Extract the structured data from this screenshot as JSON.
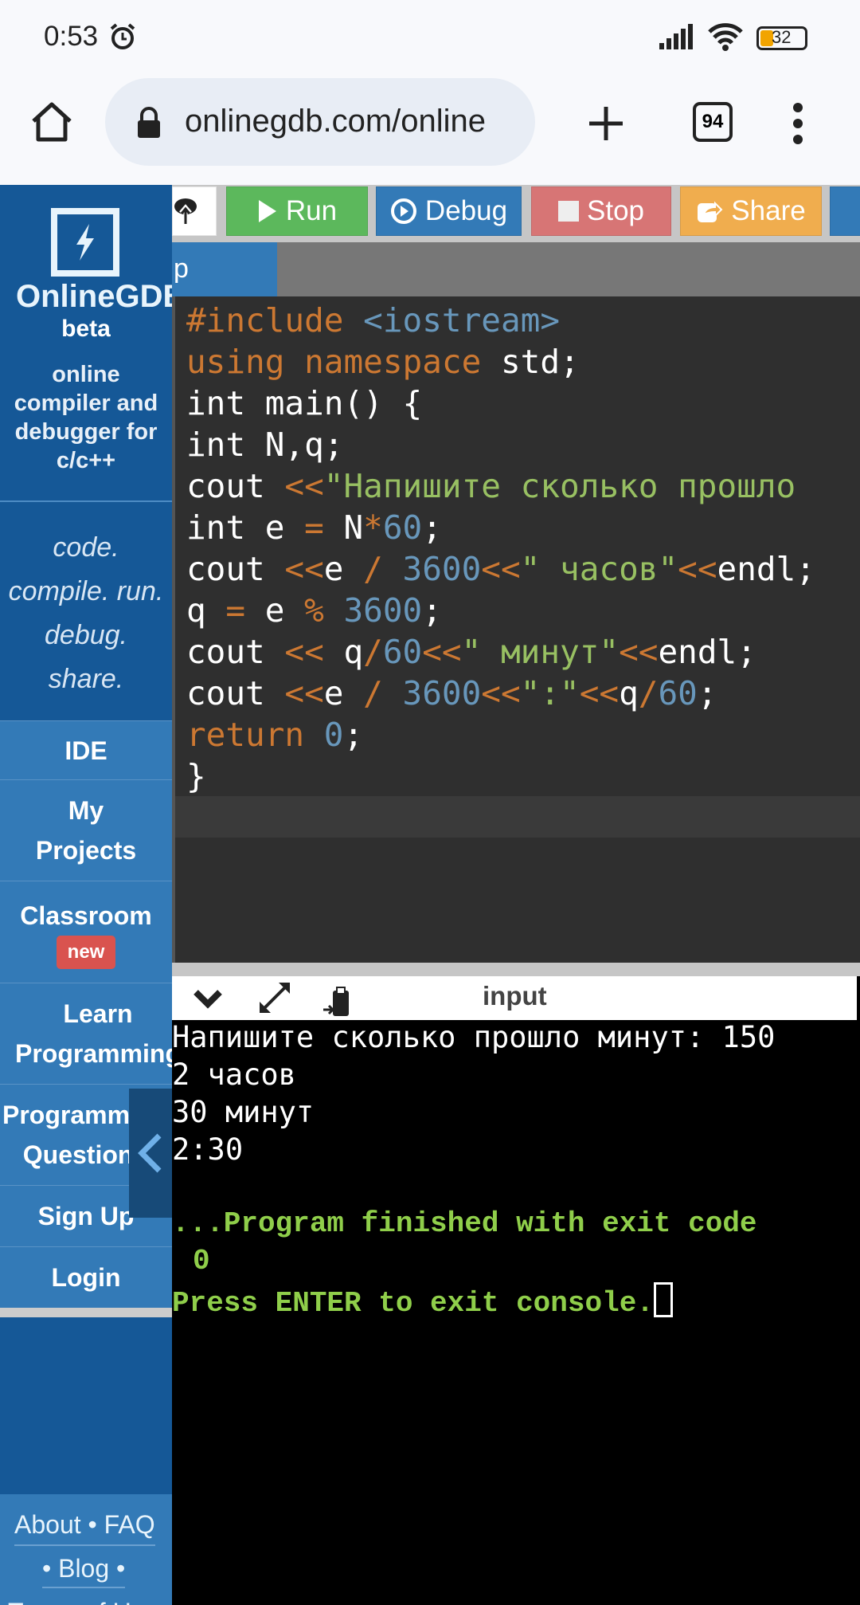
{
  "status_bar": {
    "time": "0:53",
    "battery": "32"
  },
  "browser": {
    "url": "onlinegdb.com/online",
    "tab_count": "94"
  },
  "sidebar": {
    "brand": "OnlineGDB",
    "beta": "beta",
    "description": [
      "online",
      "compiler and",
      "debugger for",
      "c/c++"
    ],
    "tagline": [
      "code.",
      "compile. run.",
      "debug.",
      "share."
    ],
    "items": [
      {
        "label": "IDE"
      },
      {
        "label": "My Projects"
      },
      {
        "label": "Classroom",
        "badge": "new"
      },
      {
        "label": "Learn Programming"
      },
      {
        "label": "Programming Questions"
      },
      {
        "label": "Sign Up"
      },
      {
        "label": "Login"
      }
    ],
    "footer": {
      "about": "About",
      "faq": "FAQ",
      "blog": "Blog",
      "terms": "Terms of Use"
    }
  },
  "toolbar": {
    "run": "Run",
    "debug": "Debug",
    "stop": "Stop",
    "share": "Share"
  },
  "tab": {
    "label": "p"
  },
  "code": [
    "#include <iostream>",
    "using namespace std;",
    "int main() {",
    "int N,q;",
    "cout <<\"Напишите сколько прошло",
    "int e = N*60;",
    "cout <<e / 3600<<\" часов\"<<endl;",
    "q = e % 3600;",
    "cout << q/60<<\" минут\"<<endl;",
    "cout <<e / 3600<<\":\"<<q/60;",
    "return 0;",
    "}"
  ],
  "console": {
    "header": "input",
    "output": [
      "Напишите сколько прошло минут: 150",
      "2 часов",
      "30 минут",
      "2:30"
    ],
    "finish": [
      "...Program finished with exit code",
      "0",
      "Press ENTER to exit console."
    ]
  }
}
